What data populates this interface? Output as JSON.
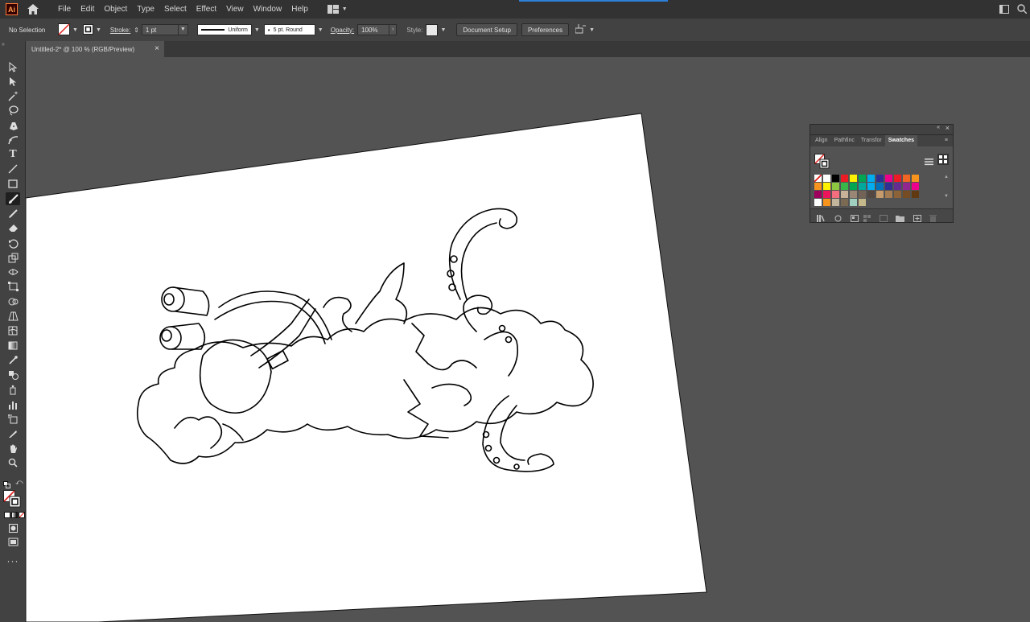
{
  "menubar": {
    "app_logo": "Ai",
    "items": [
      "File",
      "Edit",
      "Object",
      "Type",
      "Select",
      "Effect",
      "View",
      "Window",
      "Help"
    ]
  },
  "controlbar": {
    "selection_status": "No Selection",
    "stroke_label": "Stroke:",
    "stroke_weight": "1 pt",
    "profile_label": "Uniform",
    "brush_label": "5 pt. Round",
    "opacity_label": "Opacity:",
    "opacity_value": "100%",
    "style_label": "Style:",
    "document_setup_button": "Document Setup",
    "preferences_button": "Preferences"
  },
  "document_tab": {
    "title": "Untitled-2* @ 100 % (RGB/Preview)",
    "close": "×"
  },
  "swatches_panel": {
    "tabs": [
      "Align",
      "Pathfinc",
      "Transfor",
      "Swatches"
    ],
    "active_tab": "Swatches",
    "colors": [
      [
        "#ffffff",
        "#ffffff",
        "#000000",
        "#ed1c24",
        "#fff200",
        "#00a651",
        "#00aeef",
        "#2e3192",
        "#ec008c",
        "#ed1c24",
        "#f26522",
        "#f7941d"
      ],
      [
        "#f7941d",
        "#fff200",
        "#8dc63f",
        "#39b54a",
        "#00a651",
        "#00a99d",
        "#00aeef",
        "#0072bc",
        "#2e3192",
        "#662d91",
        "#92278f",
        "#ec008c"
      ],
      [
        "#9e005d",
        "#ed145b",
        "#f26d7d",
        "#c7b299",
        "#998675",
        "#736357",
        "#534741",
        "#c69c6d",
        "#a67c52",
        "#8c6239",
        "#754c24",
        "#603913"
      ],
      [
        "#ffffff",
        "#f7941d",
        "#c2b59b",
        "#7a6a53",
        "#a0d0c0",
        "#c5b88a"
      ]
    ]
  },
  "icons": [
    "home-icon",
    "workspace-switcher-icon",
    "arrange-documents-icon",
    "search-icon"
  ]
}
